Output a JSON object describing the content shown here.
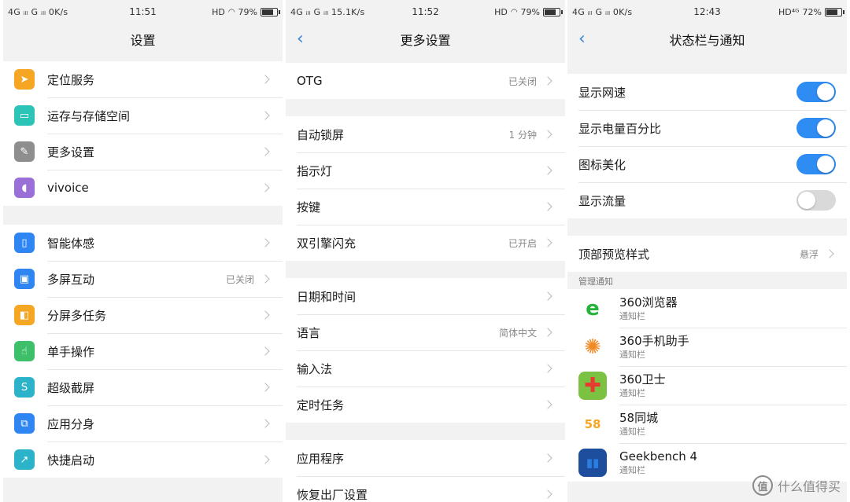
{
  "panel1": {
    "status": {
      "signal": "4G ᵢₗₗ G ᵢₗₗ 0K/s",
      "time": "11:51",
      "hd": "HD",
      "battery": "79%"
    },
    "title": "设置",
    "group1": [
      {
        "label": "定位服务",
        "icon_color": "#f5a623",
        "icon": "location-icon",
        "glyph": "➤"
      },
      {
        "label": "运存与存储空间",
        "icon_color": "#2cc4b6",
        "icon": "sd-card-icon",
        "glyph": "▭"
      },
      {
        "label": "更多设置",
        "icon_color": "#8e8e8e",
        "icon": "wrench-icon",
        "glyph": "✎"
      },
      {
        "label": "vivoice",
        "icon_color": "#9b6fd8",
        "icon": "microphone-icon",
        "glyph": "◖"
      }
    ],
    "group2": [
      {
        "label": "智能体感",
        "icon_color": "#2f86f2",
        "icon": "phone-motion-icon",
        "glyph": "▯",
        "value": ""
      },
      {
        "label": "多屏互动",
        "icon_color": "#2f86f2",
        "icon": "screen-share-icon",
        "glyph": "▣",
        "value": "已关闭"
      },
      {
        "label": "分屏多任务",
        "icon_color": "#f5a623",
        "icon": "split-screen-icon",
        "glyph": "◧",
        "value": ""
      },
      {
        "label": "单手操作",
        "icon_color": "#3ec06b",
        "icon": "one-hand-icon",
        "glyph": "☝",
        "value": ""
      },
      {
        "label": "超级截屏",
        "icon_color": "#2cb3c9",
        "icon": "screenshot-icon",
        "glyph": "S",
        "value": ""
      },
      {
        "label": "应用分身",
        "icon_color": "#2f86f2",
        "icon": "app-clone-icon",
        "glyph": "⧉",
        "value": ""
      },
      {
        "label": "快捷启动",
        "icon_color": "#2cb3c9",
        "icon": "quick-launch-icon",
        "glyph": "↗",
        "value": ""
      }
    ]
  },
  "panel2": {
    "status": {
      "signal": "4G ᵢₗₗ G ᵢₗₗ 15.1K/s",
      "time": "11:52",
      "hd": "HD",
      "battery": "79%"
    },
    "title": "更多设置",
    "group1": [
      {
        "label": "OTG",
        "value": "已关闭"
      }
    ],
    "group2": [
      {
        "label": "自动锁屏",
        "value": "1 分钟"
      },
      {
        "label": "指示灯",
        "value": ""
      },
      {
        "label": "按键",
        "value": ""
      },
      {
        "label": "双引擎闪充",
        "value": "已开启"
      }
    ],
    "group3": [
      {
        "label": "日期和时间",
        "value": ""
      },
      {
        "label": "语言",
        "value": "简体中文"
      },
      {
        "label": "输入法",
        "value": ""
      },
      {
        "label": "定时任务",
        "value": ""
      }
    ],
    "group4": [
      {
        "label": "应用程序",
        "value": ""
      },
      {
        "label": "恢复出厂设置",
        "value": ""
      }
    ]
  },
  "panel3": {
    "status": {
      "signal": "4G ᵢₗₗ G ᵢₗₗ 0K/s",
      "time": "12:43",
      "hd": "HD⁴ᴳ",
      "battery": "72%"
    },
    "title": "状态栏与通知",
    "toggles": [
      {
        "label": "显示网速",
        "on": true
      },
      {
        "label": "显示电量百分比",
        "on": true
      },
      {
        "label": "图标美化",
        "on": true
      },
      {
        "label": "显示流量",
        "on": false
      }
    ],
    "preview": {
      "label": "顶部预览样式",
      "value": "悬浮"
    },
    "caption": "管理通知",
    "apps": [
      {
        "name": "360浏览器",
        "sub": "通知栏",
        "icon": "360-browser-icon",
        "glyph": "e",
        "fg": "#25b33a",
        "bg": "#ffffff"
      },
      {
        "name": "360手机助手",
        "sub": "通知栏",
        "icon": "360-assistant-icon",
        "glyph": "✺",
        "fg": "#f08a24",
        "bg": "#ffffff"
      },
      {
        "name": "360卫士",
        "sub": "通知栏",
        "icon": "360-security-icon",
        "glyph": "✚",
        "fg": "#e63b2e",
        "bg": "#7cc242"
      },
      {
        "name": "58同城",
        "sub": "通知栏",
        "icon": "58-city-icon",
        "glyph": "58",
        "fg": "#f5a623",
        "bg": "#ffffff"
      },
      {
        "name": "Geekbench 4",
        "sub": "通知栏",
        "icon": "geekbench-icon",
        "glyph": "▮▮",
        "fg": "#2a7de1",
        "bg": "#1d4e9e"
      }
    ]
  },
  "watermark": {
    "badge": "值",
    "text": "什么值得买"
  }
}
